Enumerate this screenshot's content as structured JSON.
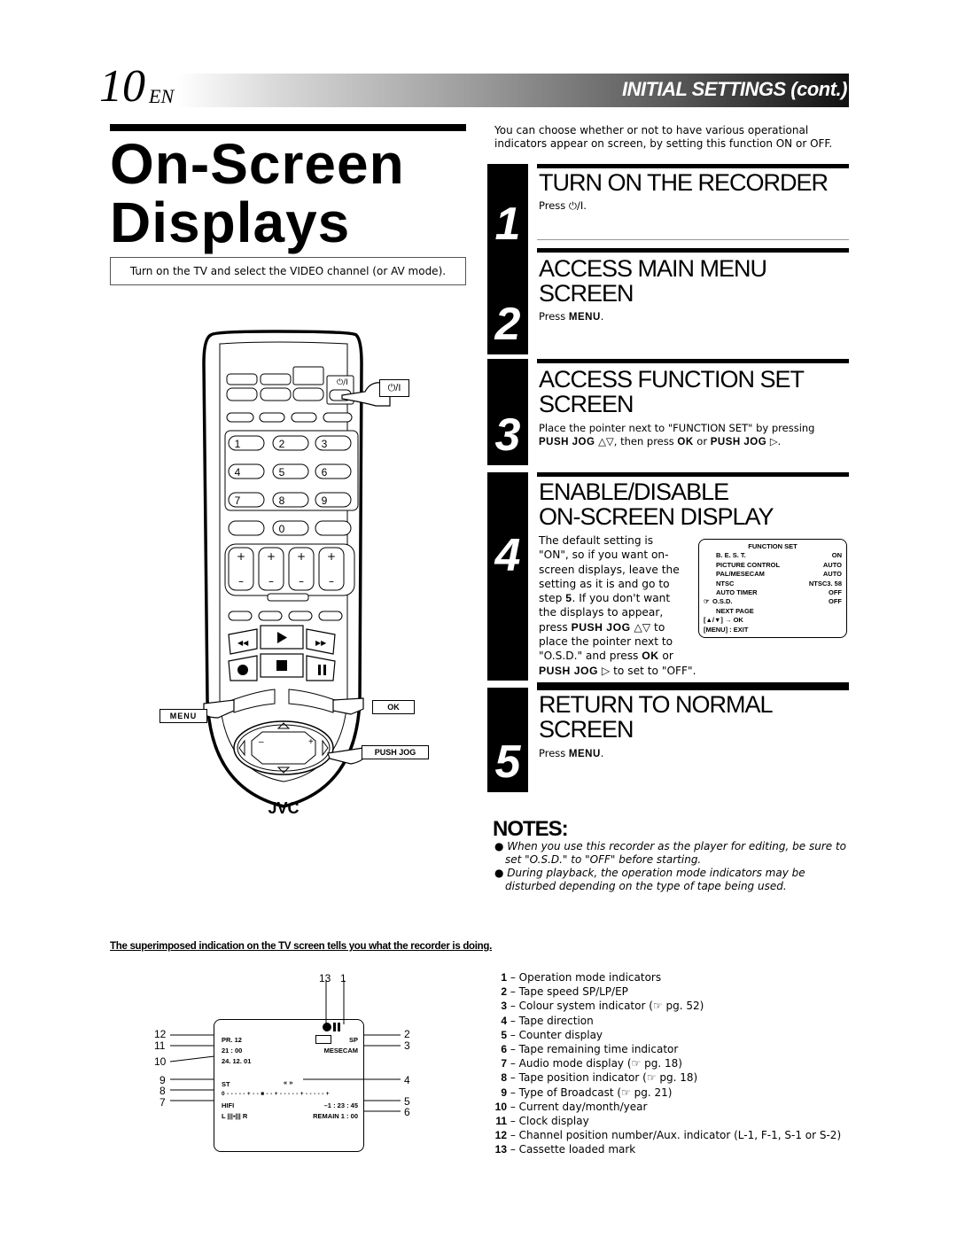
{
  "header": {
    "page_number": "10",
    "lang": "EN",
    "section": "INITIAL SETTINGS",
    "section_suffix": "(cont.)"
  },
  "title": {
    "line1": "On-Screen",
    "line2": "Displays"
  },
  "tv_note": "Turn on the TV and select the VIDEO channel (or AV mode).",
  "intro": "You can choose whether or not to have various operational indicators appear on screen, by setting this function ON or OFF.",
  "steps": [
    {
      "num": "1",
      "heading": [
        "TURN ON THE RECORDER"
      ],
      "body": "Press ⏻/I."
    },
    {
      "num": "2",
      "heading": [
        "ACCESS MAIN MENU",
        "SCREEN"
      ],
      "body_pre": "Press ",
      "body_key": "MENU",
      "body_post": "."
    },
    {
      "num": "3",
      "heading": [
        "ACCESS FUNCTION SET",
        "SCREEN"
      ],
      "body_line1": "Place the pointer next to \"FUNCTION SET\" by pressing",
      "key1": "PUSH JOG",
      "mid1": " △▽, then press ",
      "key2": "OK",
      "mid2": " or ",
      "key3": "PUSH JOG",
      "end": " ▷."
    },
    {
      "num": "4",
      "heading": [
        "ENABLE/DISABLE",
        "ON-SCREEN DISPLAY"
      ],
      "body_lines": [
        "The default setting is",
        "\"ON\", so if you want on-",
        "screen displays, leave the",
        "setting as it is and go to"
      ],
      "l5_pre": "step ",
      "l5_key": "5",
      "l5_post": ". If you don't want",
      "l6": "the displays to appear,",
      "l7_pre": "press ",
      "l7_key": "PUSH JOG",
      "l7_post": " △▽ to",
      "l8": "place the pointer next to",
      "l9_pre": "\"O.S.D.\" and press ",
      "l9_key": "OK",
      "l9_post": " or",
      "l10_key": "PUSH JOG",
      "l10_post": " ▷ to set to \"OFF\"."
    },
    {
      "num": "5",
      "heading": [
        "RETURN TO NORMAL",
        "SCREEN"
      ],
      "body_pre": "Press ",
      "body_key": "MENU",
      "body_post": "."
    }
  ],
  "function_set": {
    "title": "FUNCTION SET",
    "rows": [
      {
        "label": "B. E. S. T.",
        "value": "ON"
      },
      {
        "label": "PICTURE CONTROL",
        "value": "AUTO"
      },
      {
        "label": "PAL/MESECAM",
        "value": "AUTO"
      },
      {
        "label": "NTSC",
        "value": "NTSC3. 58"
      },
      {
        "label": "AUTO TIMER",
        "value": "OFF"
      },
      {
        "label": "O.S.D.",
        "value": "OFF",
        "pointer": true
      },
      {
        "label": "NEXT PAGE",
        "value": ""
      }
    ],
    "nav": "[▲/▼] → OK",
    "exit": "[MENU] : EXIT"
  },
  "remote": {
    "brand": "JVC",
    "callouts": {
      "power": "⏻/I",
      "menu": "MENU",
      "ok": "OK",
      "push_jog": "PUSH JOG"
    },
    "numpad": [
      "1",
      "2",
      "3",
      "4",
      "5",
      "6",
      "7",
      "8",
      "9",
      "0"
    ],
    "badges": [
      "1",
      "2",
      "3",
      "4"
    ]
  },
  "notes": {
    "title": "NOTES:",
    "items": [
      "When you use this recorder as the player for editing, be sure to set \"O.S.D.\" to  \"OFF\" before starting.",
      "During playback, the operation mode indicators may be disturbed depending on the type of tape being used."
    ]
  },
  "superimposed_caption": "The superimposed indication on the TV screen tells you what the recorder is doing.",
  "tv_screen": {
    "channel": "PR.  12",
    "clock": "21 : 00",
    "date": "24. 12. 01",
    "broadcast": "ST",
    "position_bar": "0 - - - - - + - - ■ - - + - - - - - + - - - - - +",
    "audio": "HIFI",
    "audio_meter": "L |||▪||| R",
    "speed": "SP",
    "colour": "MESECAM",
    "direction": "«  »",
    "counter": "–1 : 23 : 45",
    "remain": "REMAIN  1 : 00",
    "callout_left": [
      "12",
      "11",
      "10",
      "9",
      "8",
      "7"
    ],
    "callout_right": [
      "2",
      "3",
      "4",
      "5",
      "6"
    ],
    "callout_top": [
      "13",
      "1"
    ]
  },
  "legend": [
    {
      "n": "1",
      "text": "Operation mode indicators"
    },
    {
      "n": "2",
      "text": "Tape speed SP/LP/EP"
    },
    {
      "n": "3",
      "text": "Colour system indicator (☞ pg. 52)"
    },
    {
      "n": "4",
      "text": "Tape direction"
    },
    {
      "n": "5",
      "text": "Counter display"
    },
    {
      "n": "6",
      "text": "Tape remaining time indicator"
    },
    {
      "n": "7",
      "text": "Audio mode display (☞ pg. 18)"
    },
    {
      "n": "8",
      "text": "Tape position indicator (☞ pg. 18)"
    },
    {
      "n": "9",
      "text": "Type of Broadcast (☞ pg. 21)"
    },
    {
      "n": "10",
      "text": "Current day/month/year"
    },
    {
      "n": "11",
      "text": "Clock display"
    },
    {
      "n": "12",
      "text": "Channel position number/Aux. indicator (L-1, F-1, S-1 or S-2)"
    },
    {
      "n": "13",
      "text": "Cassette loaded mark"
    }
  ]
}
